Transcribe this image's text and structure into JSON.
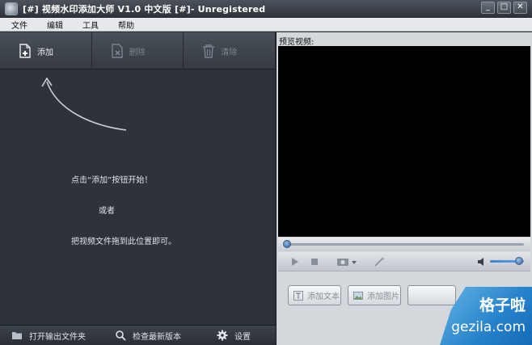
{
  "window": {
    "title": "[#] 视频水印添加大师 V1.0 中文版 [#]- Unregistered",
    "minimize_glyph": "_",
    "maximize_glyph": "□",
    "close_glyph": "✕"
  },
  "menu": {
    "items": [
      {
        "label": "文件"
      },
      {
        "label": "编辑"
      },
      {
        "label": "工具"
      },
      {
        "label": "帮助"
      }
    ]
  },
  "toolbar": {
    "add_label": "添加",
    "delete_label": "删除",
    "clear_label": "清除"
  },
  "hint": {
    "line1": "点击“添加”按钮开始！",
    "line2": "或者",
    "line3": "把视频文件拖到此位置即可。"
  },
  "footer": {
    "open_output_label": "打开输出文件夹",
    "check_update_label": "检查最新版本",
    "settings_label": "设置"
  },
  "preview": {
    "label": "预览视频:"
  },
  "player": {
    "seek_progress": 0.0,
    "volume_level": 0.85
  },
  "actions": {
    "add_text_label": "添加文本",
    "add_image_label": "添加图片",
    "third_label": ""
  },
  "watermark": {
    "brand_cn": "格子啦",
    "brand_url": "gezila.com"
  },
  "colors": {
    "left_bg": "#2e333b",
    "accent_blue": "#3e7fd0",
    "video_bg": "#000000"
  }
}
